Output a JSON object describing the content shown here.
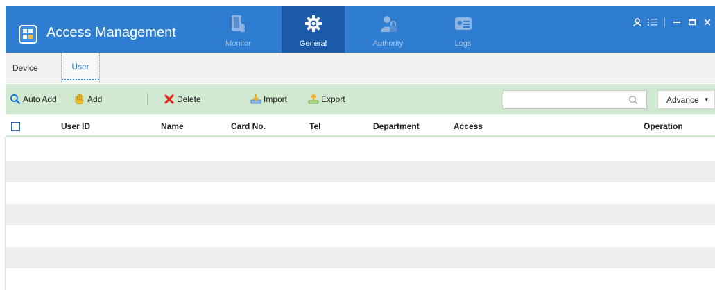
{
  "app": {
    "title": "Access Management",
    "accent_color": "#2f7dd0",
    "active_tab_color": "#1b5aa6"
  },
  "nav_tabs": [
    {
      "label": "Monitor",
      "icon": "monitor-door-icon",
      "active": false
    },
    {
      "label": "General",
      "icon": "gear-icon",
      "active": true
    },
    {
      "label": "Authority",
      "icon": "user-lock-icon",
      "active": false
    },
    {
      "label": "Logs",
      "icon": "log-card-icon",
      "active": false
    }
  ],
  "window_controls": {
    "user_icon": "user-icon",
    "menu_icon": "menu-icon",
    "minimize": "minimize-icon",
    "maximize": "maximize-icon",
    "close": "close-icon"
  },
  "sub_tabs": [
    {
      "label": "Device",
      "active": false
    },
    {
      "label": "User",
      "active": true
    }
  ],
  "toolbar": {
    "auto_add": "Auto Add",
    "add": "Add",
    "delete": "Delete",
    "import": "Import",
    "export": "Export",
    "search_placeholder": "",
    "advance": "Advance",
    "bg_color": "#d1e9d1"
  },
  "table": {
    "columns": [
      "User ID",
      "Name",
      "Card No.",
      "Tel",
      "Department",
      "Access",
      "Operation"
    ],
    "rows": []
  }
}
